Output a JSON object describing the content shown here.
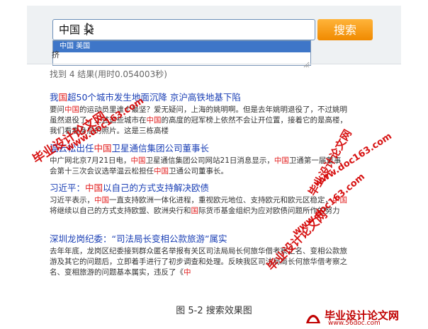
{
  "search": {
    "query": "中国 美",
    "button_label": "搜索",
    "suggestion": "中国 美国"
  },
  "sidebar_fragment": "挤",
  "results_stats": "找到 4 结果(用时0.054003秒)",
  "results": [
    {
      "title": [
        [
          "我",
          ""
        ],
        [
          "国",
          "hl"
        ],
        [
          "超50个城市发生地面沉降 京沪高铁地基下陷",
          ""
        ]
      ],
      "snippet": [
        [
          "要问",
          ""
        ],
        [
          "中国",
          "hl"
        ],
        [
          "的运动员里谁个最坚？爱无疑问，上海的姚明啊。但是去年姚明退役了，不过姚明虽然退役了，上述这些城市在",
          ""
        ],
        [
          "中国",
          "hl"
        ],
        [
          "的高度的冠军榜上依然不会让开位置，接着它的是高楼，我们看看身后的照片。这是三栋高楼",
          ""
        ]
      ]
    },
    {
      "title": [
        [
          "温云松出任",
          ""
        ],
        [
          "中国",
          "hl"
        ],
        [
          "卫星通信集团公司董事长",
          ""
        ]
      ],
      "snippet": [
        [
          "中广网北京7月21日电，",
          ""
        ],
        [
          "中国",
          "hl"
        ],
        [
          "卫星通信集团公司网站21日消息显示，",
          ""
        ],
        [
          "中国",
          "hl"
        ],
        [
          "卫通第一届董事会第十三次会议选举温云松担任",
          ""
        ],
        [
          "中国",
          "hl"
        ],
        [
          "卫通公司董事长。",
          ""
        ]
      ]
    },
    {
      "title": [
        [
          "习近平：",
          ""
        ],
        [
          "中国",
          "hl"
        ],
        [
          "以自己的方式支持解决欧债",
          ""
        ]
      ],
      "snippet": [
        [
          "习近平表示，",
          ""
        ],
        [
          "中国",
          "hl"
        ],
        [
          "一直支持欧洲一体化进程，重视欧元地位、支持欧元和欧元区稳定，",
          ""
        ],
        [
          "中国",
          "hl"
        ],
        [
          "将继续以自己的方式支持欧盟、欧洲央行和",
          ""
        ],
        [
          "国",
          "hl"
        ],
        [
          "际货币基金组织为应对欧债问题所作的努力",
          ""
        ]
      ]
    },
    {
      "title": [
        [
          "深圳龙岗纪委：“司法局长变相公款旅游”属实",
          ""
        ]
      ],
      "snippet": [
        [
          "去年年底，龙岗区纪委接到群众匿名举报有关区司法局局长何旅华借考察之名、变相公款旅游及其它的问题后，立即着手进行了初步调查和处理。反映我区司法局局长何旅华借考察之名、变相旅游的问题基本属实，违反了《",
          ""
        ],
        [
          "中",
          "hl"
        ]
      ]
    }
  ],
  "watermarks": [
    "毕业设计论文网",
    "www.doc163.com",
    "www.doc163.com",
    "毕业设计论文网",
    "毕业设计论文网",
    "www.doc163.com"
  ],
  "caption": "图 5-2 搜索效果图",
  "footer": {
    "logo_title": "毕业设计论文网",
    "logo_url": "www.56doc.com"
  }
}
